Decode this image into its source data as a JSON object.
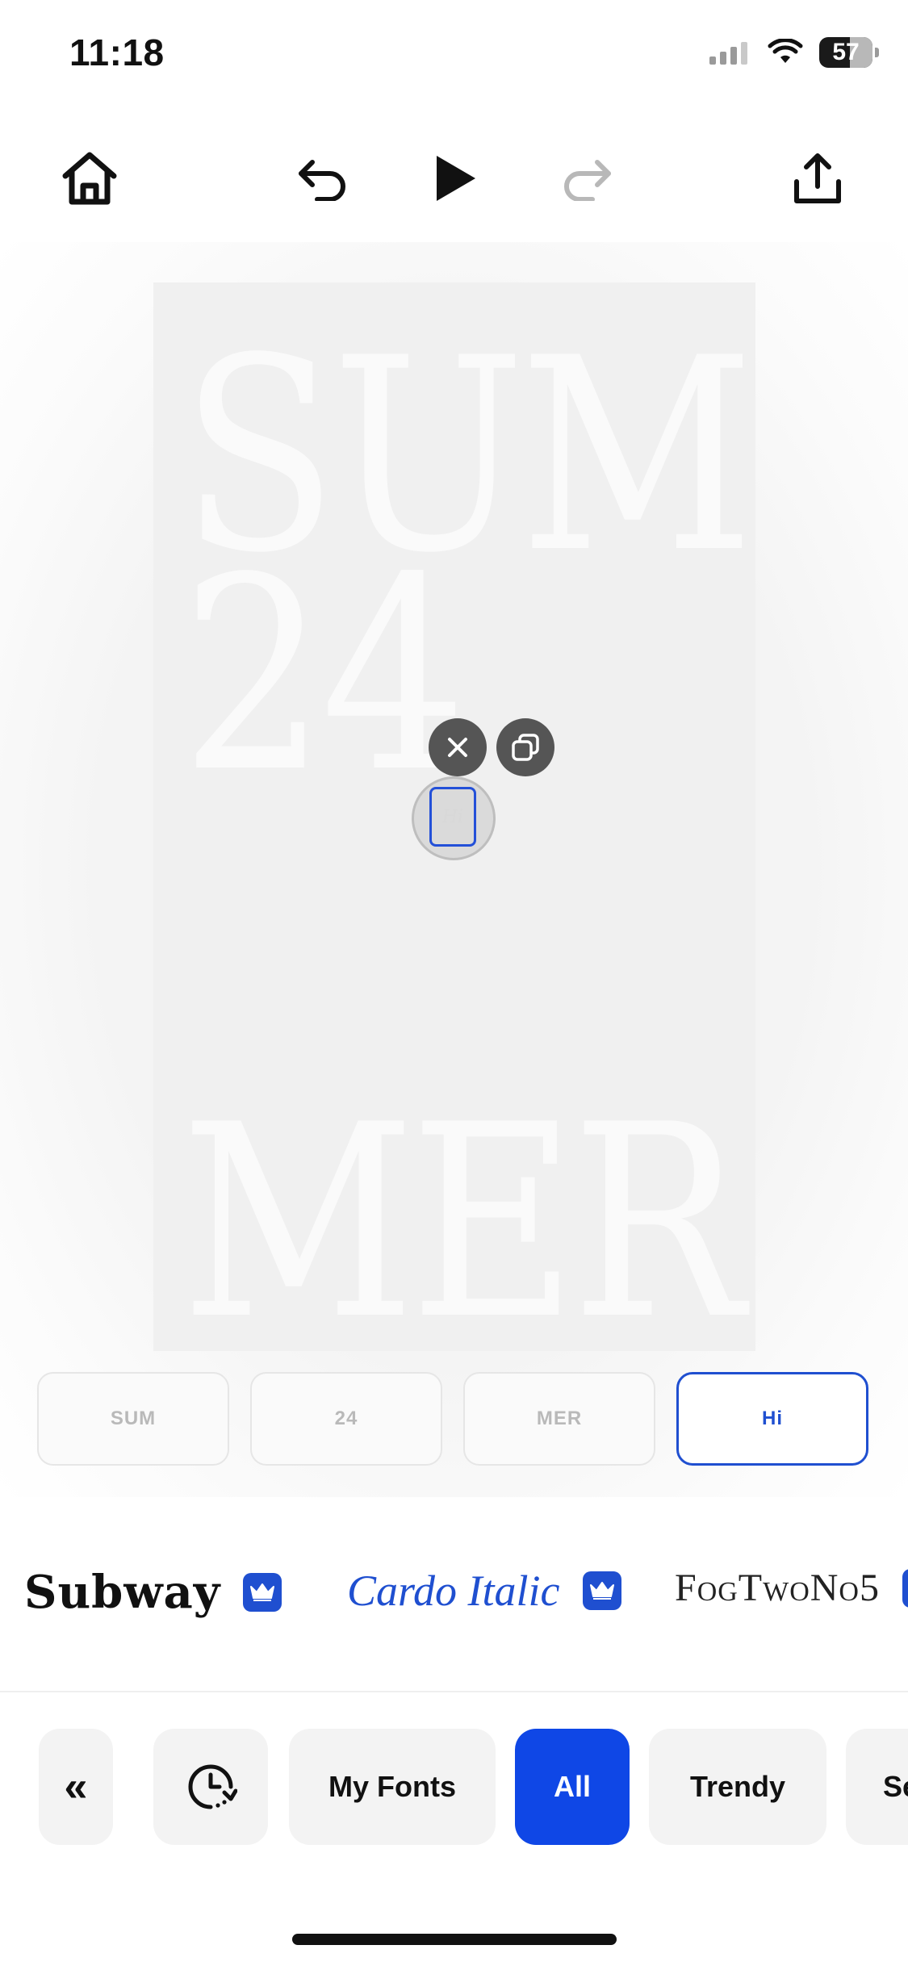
{
  "status_bar": {
    "time": "11:18",
    "battery": "57"
  },
  "toolbar": {
    "home": "home-icon",
    "undo": "undo-icon",
    "play": "play-icon",
    "redo": "redo-icon",
    "share": "share-icon"
  },
  "poster": {
    "line1": "SUM",
    "line2": "24",
    "line3": "MER"
  },
  "selection": {
    "text": "Hi"
  },
  "layers": [
    {
      "label": "SUM"
    },
    {
      "label": "24"
    },
    {
      "label": "MER"
    },
    {
      "label": "Hi",
      "active": true
    }
  ],
  "fonts": [
    {
      "name": "Subway",
      "premium": true
    },
    {
      "name": "Cardo Italic",
      "premium": true,
      "selected": true
    },
    {
      "name": "FogTwoNo5",
      "premium": true
    }
  ],
  "categories": {
    "collapse": "«",
    "recent": "recent-clock-icon",
    "items": [
      "My Fonts",
      "All",
      "Trendy",
      "Se"
    ],
    "active": "All"
  },
  "colors": {
    "accent": "#0f47e6",
    "chip_active": "#1f4fd0"
  }
}
